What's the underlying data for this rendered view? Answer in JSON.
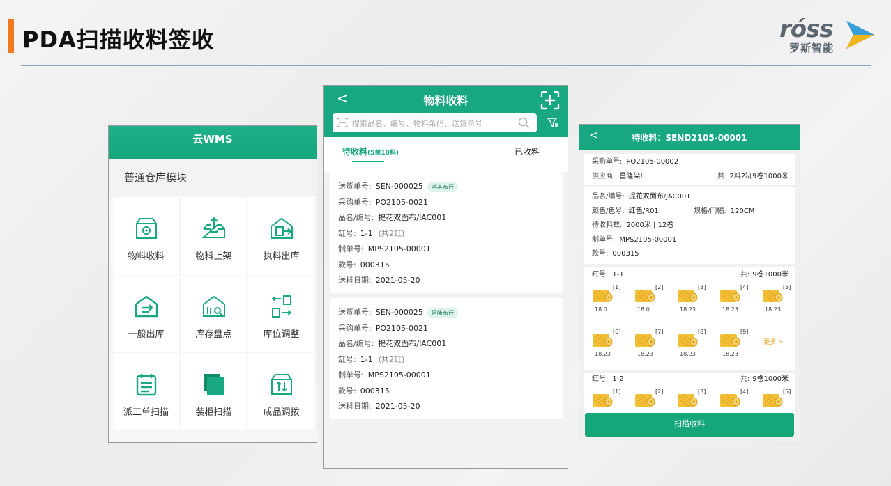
{
  "slide": {
    "title": "PDA扫描收料签收"
  },
  "logo": {
    "text": "róss",
    "sub": "罗斯智能"
  },
  "home": {
    "title": "云WMS",
    "section": "普通仓库模块",
    "items": [
      {
        "label": "物料收料",
        "icon": "box-gear-icon"
      },
      {
        "label": "物料上架",
        "icon": "tray-upload-icon"
      },
      {
        "label": "执料出库",
        "icon": "warehouse-out-icon"
      },
      {
        "label": "一般出库",
        "icon": "house-exit-icon"
      },
      {
        "label": "库存盘点",
        "icon": "warehouse-search-icon"
      },
      {
        "label": "库位调整",
        "icon": "swap-location-icon"
      },
      {
        "label": "派工单扫描",
        "icon": "clipboard-list-icon"
      },
      {
        "label": "装柜扫描",
        "icon": "stack-square-icon"
      },
      {
        "label": "成品调拨",
        "icon": "transfer-box-icon"
      }
    ]
  },
  "receive": {
    "title": "物料收料",
    "back": "<",
    "search_placeholder": "搜索品名、编号、物料条码、送货单号",
    "tab_pending": "待收料",
    "tab_pending_count": "(5单10料)",
    "tab_done": "已收料",
    "labels": {
      "delivery": "送货单号:",
      "po": "采购单号:",
      "item": "品名/编号:",
      "vat": "缸号:",
      "order": "制单号:",
      "style": "款号:",
      "date": "送料日期:"
    },
    "cards": [
      {
        "delivery": "SEN-000025",
        "supplier": "鸿基布行",
        "po": "PO2105-0021",
        "item": "提花双面布/JAC001",
        "vat": "1-1",
        "vat_note": "(共2缸)",
        "order": "MPS2105-00001",
        "style": "000315",
        "date": "2021-05-20"
      },
      {
        "delivery": "SEN-000025",
        "supplier": "昌隆布行",
        "po": "PO2105-0021",
        "item": "提花双面布/JAC001",
        "vat": "1-1",
        "vat_note": "(共2缸)",
        "order": "MPS2105-00001",
        "style": "000315",
        "date": "2021-05-20"
      }
    ]
  },
  "detail": {
    "back": "<",
    "title": "待收料：SEND2105-00001",
    "po_label": "采购单号:",
    "po": "PO2105-00002",
    "supplier_label": "供应商:",
    "supplier": "昌隆染厂",
    "total_label": "共:",
    "total": "2料2缸9卷1000米",
    "item_label": "品名/编号:",
    "item": "提花双面布/JAC001",
    "color_label": "颜色/色号:",
    "color": "红色/R01",
    "spec_label": "规格/门幅:",
    "spec": "120CM",
    "qty_label": "待收料数:",
    "qty": "2000米 | 12卷",
    "order_label": "制单号:",
    "order": "MPS2105-00001",
    "style_label": "款号:",
    "style": "000315",
    "vat_label": "缸号:",
    "vats": [
      {
        "vat": "1-1",
        "total_label": "共:",
        "total": "9卷1000米",
        "rolls": [
          {
            "idx": "[1]",
            "val": "18.0"
          },
          {
            "idx": "[2]",
            "val": "18.0"
          },
          {
            "idx": "[3]",
            "val": "18.23"
          },
          {
            "idx": "[4]",
            "val": "18.23"
          },
          {
            "idx": "[5]",
            "val": "18.23"
          },
          {
            "idx": "[6]",
            "val": "18.23"
          },
          {
            "idx": "[7]",
            "val": "18.23"
          },
          {
            "idx": "[8]",
            "val": "18.23"
          },
          {
            "idx": "[9]",
            "val": "18.23"
          }
        ],
        "more": "更多 >"
      },
      {
        "vat": "1-2",
        "total_label": "共:",
        "total": "9卷1000米",
        "rolls": [
          {
            "idx": "[1]"
          },
          {
            "idx": "[2]"
          },
          {
            "idx": "[3]"
          },
          {
            "idx": "[4]"
          },
          {
            "idx": "[5]"
          }
        ]
      }
    ],
    "scan_button": "扫描收料"
  },
  "colors": {
    "primary": "#17a882",
    "accent": "#f07a1c",
    "roll": "#f2c037"
  }
}
